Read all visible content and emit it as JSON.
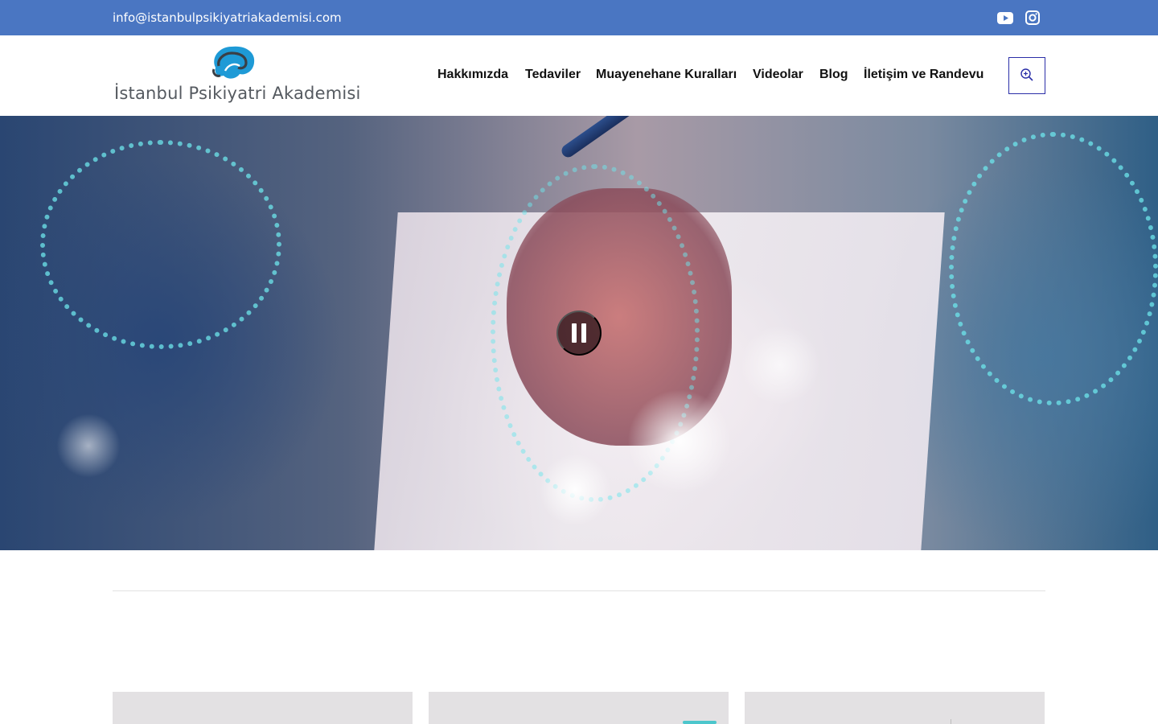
{
  "topbar": {
    "email": "info@istanbulpsikiyatriakademisi.com",
    "social": [
      {
        "icon": "youtube-icon"
      },
      {
        "icon": "instagram-icon"
      }
    ]
  },
  "header": {
    "logo_text": "İstanbul Psikiyatri Akademisi",
    "nav": [
      {
        "label": "Hakkımızda"
      },
      {
        "label": "Tedaviler"
      },
      {
        "label": "Muayenehane Kuralları"
      },
      {
        "label": "Videolar"
      },
      {
        "label": "Blog"
      },
      {
        "label": "İletişim ve Randevu"
      }
    ],
    "search_icon": "search-icon"
  },
  "hero": {
    "control_icon": "pause-icon"
  },
  "colors": {
    "topbar": "#4a76c2",
    "search_border": "#2b2fa8",
    "nav_text": "#111111",
    "logo_blue": "#1e9ad6"
  }
}
